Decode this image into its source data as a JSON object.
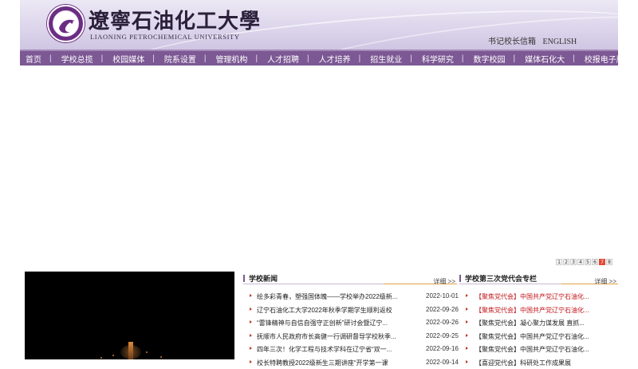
{
  "header": {
    "cn_name": "遼寧石油化工大學",
    "en_name": "LIAONING PETROCHEMICAL UNIVERSITY",
    "toplinks": [
      "书记校长信箱",
      "ENGLISH"
    ]
  },
  "nav": {
    "items": [
      "首页",
      "学校总揽",
      "校园媒体",
      "院系设置",
      "管理机构",
      "人才招聘",
      "人才培养",
      "招生就业",
      "科学研究",
      "数字校园",
      "媒体石化大",
      "校报电子版"
    ]
  },
  "pager": {
    "pages": [
      "1",
      "2",
      "3",
      "4",
      "5",
      "6",
      "7",
      "8"
    ],
    "active": "7"
  },
  "news": {
    "title": "学校新闻",
    "more": "详细 >>",
    "items": [
      {
        "text": "绘多彩青春，塑强国体魄——学校举办2022级新...",
        "date": "2022-10-01"
      },
      {
        "text": "辽宁石油化工大学2022年秋季学期学生顺利返校",
        "date": "2022-09-26"
      },
      {
        "text": "“雷锋精神与自信自强守正创新”研讨会暨辽宁...",
        "date": "2022-09-26"
      },
      {
        "text": "抚顺市人民政府市长高健一行调研督导学校秋季...",
        "date": "2022-09-25"
      },
      {
        "text": "四年三次！化学工程与技术学科在辽宁省“双一...",
        "date": "2022-09-16"
      },
      {
        "text": "校长特聘教授2022级新生三期讲座“开学第一课",
        "date": "2022-09-14"
      }
    ]
  },
  "party": {
    "title": "学校第三次党代会专栏",
    "more": "详细 >>",
    "items": [
      {
        "text": "【聚焦党代会】中国共产党辽宁石油化...",
        "red": true
      },
      {
        "text": "【聚焦党代会】中国共产党辽宁石油化...",
        "red": true
      },
      {
        "text": "【聚焦党代会】凝心聚力谋发展  直抓...",
        "red": false
      },
      {
        "text": "【聚焦党代会】中国共产党辽宁石油化...",
        "red": false
      },
      {
        "text": "【聚焦党代会】中国共产党辽宁石油化...",
        "red": false
      },
      {
        "text": "【喜迎党代会】科研处工作成果展",
        "red": false
      }
    ]
  },
  "colors": {
    "nav_bg": "#7c5894",
    "accent_red": "#c0151a",
    "underline": "#e0a040"
  }
}
